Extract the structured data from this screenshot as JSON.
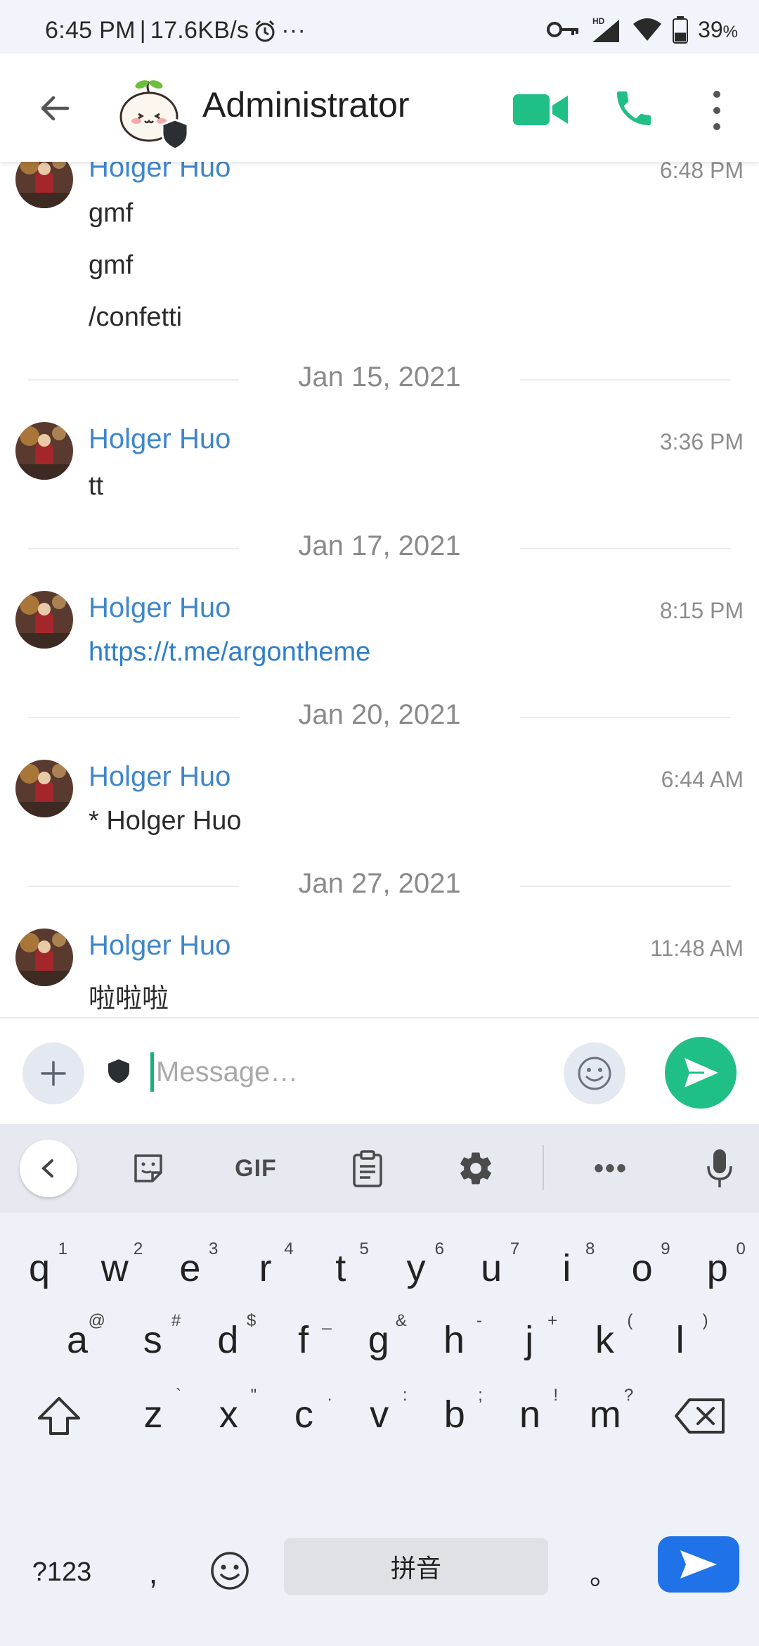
{
  "status_bar": {
    "time": "6:45 PM",
    "speed": "17.6KB/s",
    "more": "···",
    "hd": "HD",
    "battery": "39",
    "battery_unit": "%",
    "battery_level": 0.39
  },
  "header": {
    "title": "Administrator",
    "icons": {
      "back": "arrow-back-icon",
      "video": "video-call-icon",
      "call": "phone-icon",
      "menu": "more-vertical-icon"
    },
    "accent_color": "#1fbf86"
  },
  "timeline": {
    "sender_color": "#3f86cc",
    "events": [
      {
        "sender": "Holger Huo",
        "time": "6:48 PM",
        "messages": [
          "gmf",
          "gmf",
          "/confetti"
        ]
      },
      {
        "date": "Jan 15, 2021"
      },
      {
        "sender": "Holger Huo",
        "time": "3:36 PM",
        "messages": [
          "tt"
        ]
      },
      {
        "date": "Jan 17, 2021"
      },
      {
        "sender": "Holger Huo",
        "time": "8:15 PM",
        "messages": [
          "https://t.me/argontheme"
        ],
        "is_link": true
      },
      {
        "date": "Jan 20, 2021"
      },
      {
        "sender": "Holger Huo",
        "time": "6:44 AM",
        "messages": [
          "* Holger Huo"
        ]
      },
      {
        "date": "Jan 27, 2021"
      },
      {
        "sender": "Holger Huo",
        "time": "11:48 AM",
        "messages": [
          "啦啦啦"
        ]
      }
    ]
  },
  "composer": {
    "placeholder": "Message…",
    "value": "",
    "icons": {
      "attach": "plus-icon",
      "encryption": "shield-icon",
      "emoji": "smiley-icon",
      "send": "send-icon"
    }
  },
  "keyboard": {
    "toolbar": {
      "back": "chevron-left-icon",
      "sticker": "sticker-icon",
      "gif": "GIF",
      "clipboard": "clipboard-icon",
      "settings": "gear-icon",
      "more": "•••",
      "mic": "mic-icon"
    },
    "row1": [
      {
        "k": "q",
        "s": "1"
      },
      {
        "k": "w",
        "s": "2"
      },
      {
        "k": "e",
        "s": "3"
      },
      {
        "k": "r",
        "s": "4"
      },
      {
        "k": "t",
        "s": "5"
      },
      {
        "k": "y",
        "s": "6"
      },
      {
        "k": "u",
        "s": "7"
      },
      {
        "k": "i",
        "s": "8"
      },
      {
        "k": "o",
        "s": "9"
      },
      {
        "k": "p",
        "s": "0"
      }
    ],
    "row2": [
      {
        "k": "a",
        "s": "@"
      },
      {
        "k": "s",
        "s": "#"
      },
      {
        "k": "d",
        "s": "$"
      },
      {
        "k": "f",
        "s": "_"
      },
      {
        "k": "g",
        "s": "&"
      },
      {
        "k": "h",
        "s": "-"
      },
      {
        "k": "j",
        "s": "+"
      },
      {
        "k": "k",
        "s": "("
      },
      {
        "k": "l",
        "s": ")"
      }
    ],
    "row3": [
      {
        "k": "z",
        "s": "`"
      },
      {
        "k": "x",
        "s": "\""
      },
      {
        "k": "c",
        "s": "."
      },
      {
        "k": "v",
        "s": ":"
      },
      {
        "k": "b",
        "s": ";"
      },
      {
        "k": "n",
        "s": "!"
      },
      {
        "k": "m",
        "s": "?"
      }
    ],
    "symbols_label": "?123",
    "comma": ",",
    "space_label": "拼音",
    "period": "。"
  }
}
